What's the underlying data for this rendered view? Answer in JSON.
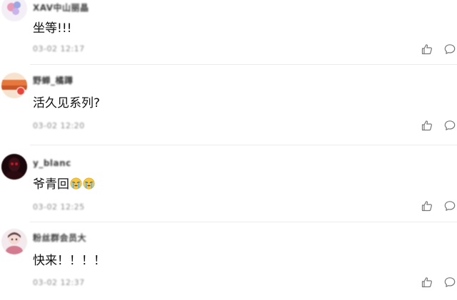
{
  "comments": [
    {
      "username": "XAV中山丽晶 ",
      "content": "坐等!!!",
      "meta": "03-02 12:17"
    },
    {
      "username": "野蝉_橘蹲",
      "content": "活久见系列?",
      "meta": "03-02 12:20"
    },
    {
      "username": "y_blanc",
      "content": "爷青回",
      "meta": "03-02 12:25"
    },
    {
      "username": "粉丝群会员大",
      "content": "快来！！！！",
      "meta": "03-02 12:37"
    }
  ],
  "icons": {
    "like": "thumbs-up-icon",
    "reply": "comment-bubble-icon",
    "emoji": "crying-face-emoji-icon"
  },
  "colors": {
    "text": "#111111",
    "meta": "#8a8a8a",
    "icon": "#777777",
    "divider": "#ececec"
  }
}
